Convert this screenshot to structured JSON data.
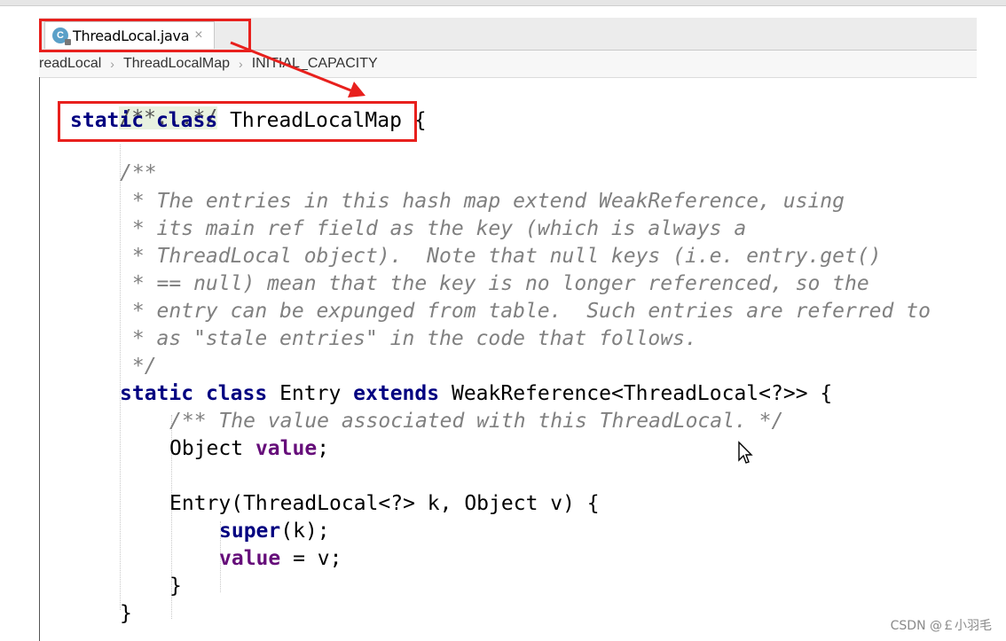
{
  "tab": {
    "icon_letter": "C",
    "label": "ThreadLocal.java",
    "close": "×"
  },
  "breadcrumb": {
    "items": [
      "readLocal",
      "ThreadLocalMap",
      "INITIAL_CAPACITY"
    ],
    "separator": "›"
  },
  "code": {
    "l01": "/**...*/",
    "l02_kw1": "static",
    "l02_kw2": "class",
    "l02_name": "ThreadLocalMap",
    "l02_brace": "{",
    "l04": "/**",
    "l05": " * The entries in this hash map extend WeakReference, using",
    "l06": " * its main ref field as the key (which is always a",
    "l07": " * ThreadLocal object).  Note that null keys (i.e. entry.get()",
    "l08": " * == null) mean that the key is no longer referenced, so the",
    "l09": " * entry can be expunged from table.  Such entries are referred to",
    "l10": " * as \"stale entries\" in the code that follows.",
    "l11": " */",
    "l12_kw1": "static",
    "l12_kw2": "class",
    "l12_name": "Entry",
    "l12_kw3": "extends",
    "l12_rest": "WeakReference<ThreadLocal<?>> {",
    "l13": "/** The value associated with this ThreadLocal. */",
    "l14_type": "Object",
    "l14_field": "value",
    "l14_end": ";",
    "l16": "Entry(ThreadLocal<?> k, Object v) {",
    "l17_kw": "super",
    "l17_rest": "(k);",
    "l18_field": "value",
    "l18_rest": " = v;",
    "l19": "}",
    "l20": "}"
  },
  "annotations": {
    "color": "#e8201d"
  },
  "watermark": "CSDN @￡小羽毛"
}
